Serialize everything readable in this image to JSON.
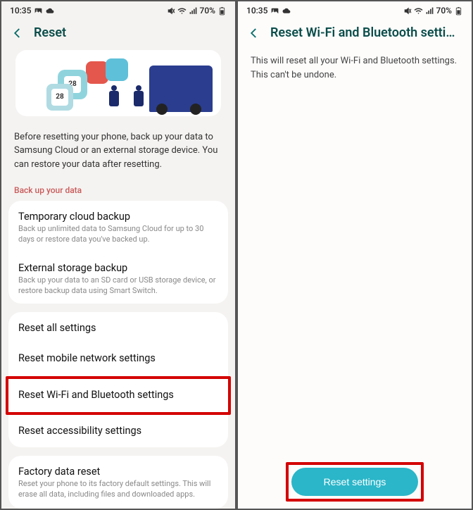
{
  "status": {
    "time": "10:35",
    "battery": "70%"
  },
  "left": {
    "title": "Reset",
    "hero_cal": "28",
    "instruction": "Before resetting your phone, back up your data to Samsung Cloud or an external storage device. You can restore your data after resetting.",
    "backup_header": "Back up your data",
    "items": {
      "tmp_cloud_title": "Temporary cloud backup",
      "tmp_cloud_sub": "Back up unlimited data to Samsung Cloud for up to 30 days or restore data you've backed up.",
      "ext_title": "External storage backup",
      "ext_sub": "Back up your data to an SD card or USB storage device, or restore backup data using Smart Switch."
    },
    "reset_items": {
      "all": "Reset all settings",
      "mobile": "Reset mobile network settings",
      "wifi": "Reset Wi-Fi and Bluetooth settings",
      "access": "Reset accessibility settings"
    },
    "factory": {
      "title": "Factory data reset",
      "sub": "Reset your phone to its factory default settings. This will erase all data, including files and downloaded apps."
    }
  },
  "right": {
    "title": "Reset Wi-Fi and Bluetooth settin...",
    "body": "This will reset all your Wi-Fi and Bluetooth settings. This can't be undone.",
    "button": "Reset settings"
  }
}
